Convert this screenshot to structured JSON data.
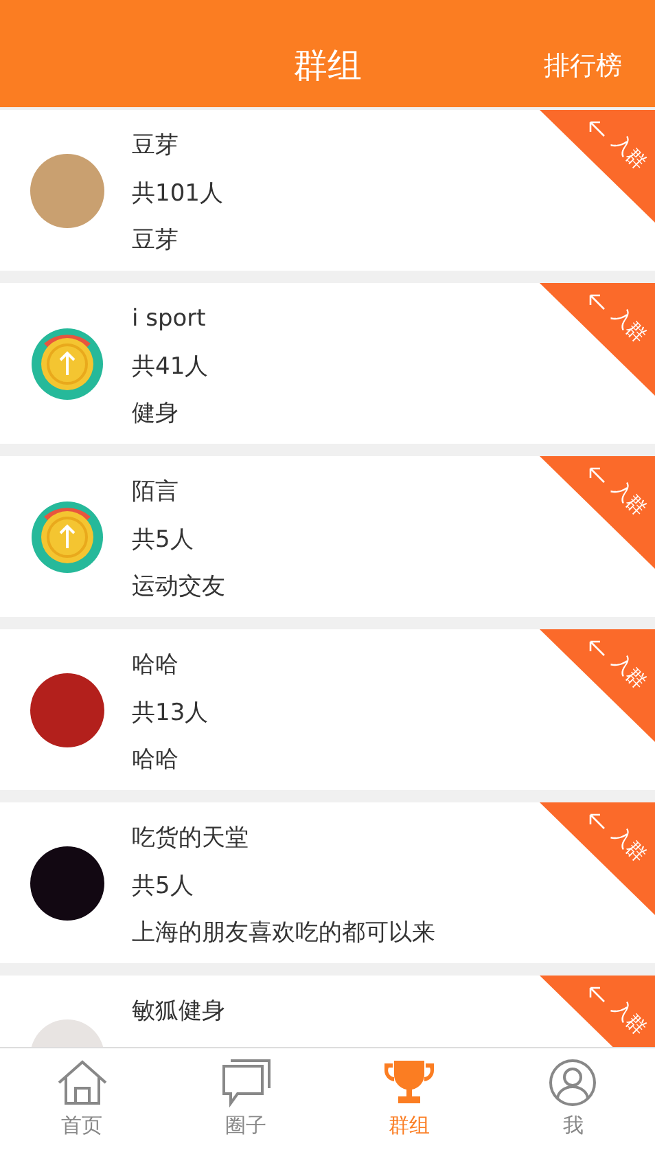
{
  "header": {
    "title": "群组",
    "action": "排行榜"
  },
  "groups": [
    {
      "name": "豆芽",
      "count": "共101人",
      "description": "豆芽",
      "badge": "入群"
    },
    {
      "name": "i sport",
      "count": "共41人",
      "description": "健身",
      "badge": "入群"
    },
    {
      "name": "陌言",
      "count": "共5人",
      "description": "运动交友",
      "badge": "入群"
    },
    {
      "name": "哈哈",
      "count": "共13人",
      "description": "哈哈",
      "badge": "入群"
    },
    {
      "name": "吃货的天堂",
      "count": "共5人",
      "description": "上海的朋友喜欢吃的都可以来",
      "badge": "入群"
    },
    {
      "name": "敏狐健身",
      "badge": "入群"
    }
  ],
  "tabs": [
    {
      "label": "首页",
      "selected": false
    },
    {
      "label": "圈子",
      "selected": false
    },
    {
      "label": "群组",
      "selected": true
    },
    {
      "label": "我",
      "selected": false
    }
  ]
}
